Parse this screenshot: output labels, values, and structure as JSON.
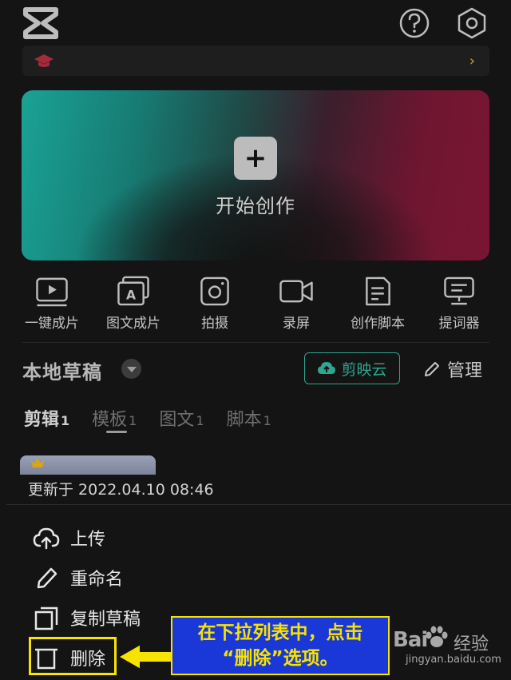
{
  "header": {
    "logo_icon": "capcut-logo-icon",
    "help_icon": "help-icon",
    "settings_icon": "settings-icon"
  },
  "banner": {
    "icon": "graduation-cap-icon",
    "chevron": "›"
  },
  "create": {
    "plus": "+",
    "label": "开始创作"
  },
  "tools": [
    {
      "label": "一键成片",
      "icon": "play-video-icon"
    },
    {
      "label": "图文成片",
      "icon": "image-text-icon"
    },
    {
      "label": "拍摄",
      "icon": "camera-icon"
    },
    {
      "label": "录屏",
      "icon": "screen-record-icon"
    },
    {
      "label": "创作脚本",
      "icon": "script-icon"
    },
    {
      "label": "提词器",
      "icon": "teleprompter-icon"
    }
  ],
  "drafts": {
    "title": "本地草稿",
    "cloud_label": "剪映云",
    "manage_label": "管理",
    "tabs": [
      {
        "label": "剪辑",
        "count": "1"
      },
      {
        "label": "模板",
        "count": "1"
      },
      {
        "label": "图文",
        "count": "1"
      },
      {
        "label": "脚本",
        "count": "1"
      }
    ],
    "updated": "更新于 2022.04.10 08:46"
  },
  "menu": {
    "upload": "上传",
    "rename": "重命名",
    "copy": "复制草稿",
    "delete": "删除"
  },
  "annotation": {
    "line1": "在下拉列表中，点击",
    "line2": "“删除”选项。"
  },
  "watermark": {
    "brand": "Bai",
    "brand2": "经验",
    "url": "jingyan.baidu.com"
  },
  "colors": {
    "accent": "#2ea690",
    "highlight": "#f7e300",
    "note_bg": "#1a37d7",
    "bg": "#141414"
  }
}
